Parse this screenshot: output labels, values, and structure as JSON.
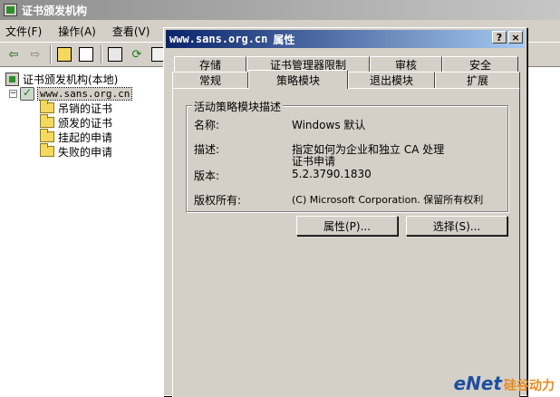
{
  "main_window": {
    "title": "证书颁发机构",
    "menu": [
      "文件(F)",
      "操作(A)",
      "查看(V)"
    ]
  },
  "tree": {
    "root": "证书颁发机构(本地)",
    "server": "www.sans.org.cn",
    "children": [
      "吊销的证书",
      "颁发的证书",
      "挂起的申请",
      "失败的申请"
    ]
  },
  "dialog": {
    "title_host": "www.sans.org.cn",
    "title_suffix": "属性",
    "help_btn": "?",
    "close_btn": "×",
    "tabs_row1": [
      "存储",
      "证书管理器限制",
      "审核",
      "安全"
    ],
    "tabs_row2": [
      "常规",
      "策略模块",
      "退出模块",
      "扩展"
    ],
    "active_tab": "策略模块",
    "group_title": "活动策略模块描述",
    "fields": {
      "name_label": "名称:",
      "name_value": "Windows 默认",
      "desc_label": "描述:",
      "desc_line1": "指定如何为企业和独立 CA 处理",
      "desc_line2": "证书申请",
      "version_label": "版本:",
      "version_value": "5.2.3790.1830",
      "copyright_label": "版权所有:",
      "copyright_value": "(C) Microsoft Corporation. 保留所有权利"
    },
    "buttons": {
      "properties": "属性(P)...",
      "select": "选择(S)..."
    }
  },
  "watermark": {
    "latin": "eNet",
    "cn": "硅谷动力"
  }
}
